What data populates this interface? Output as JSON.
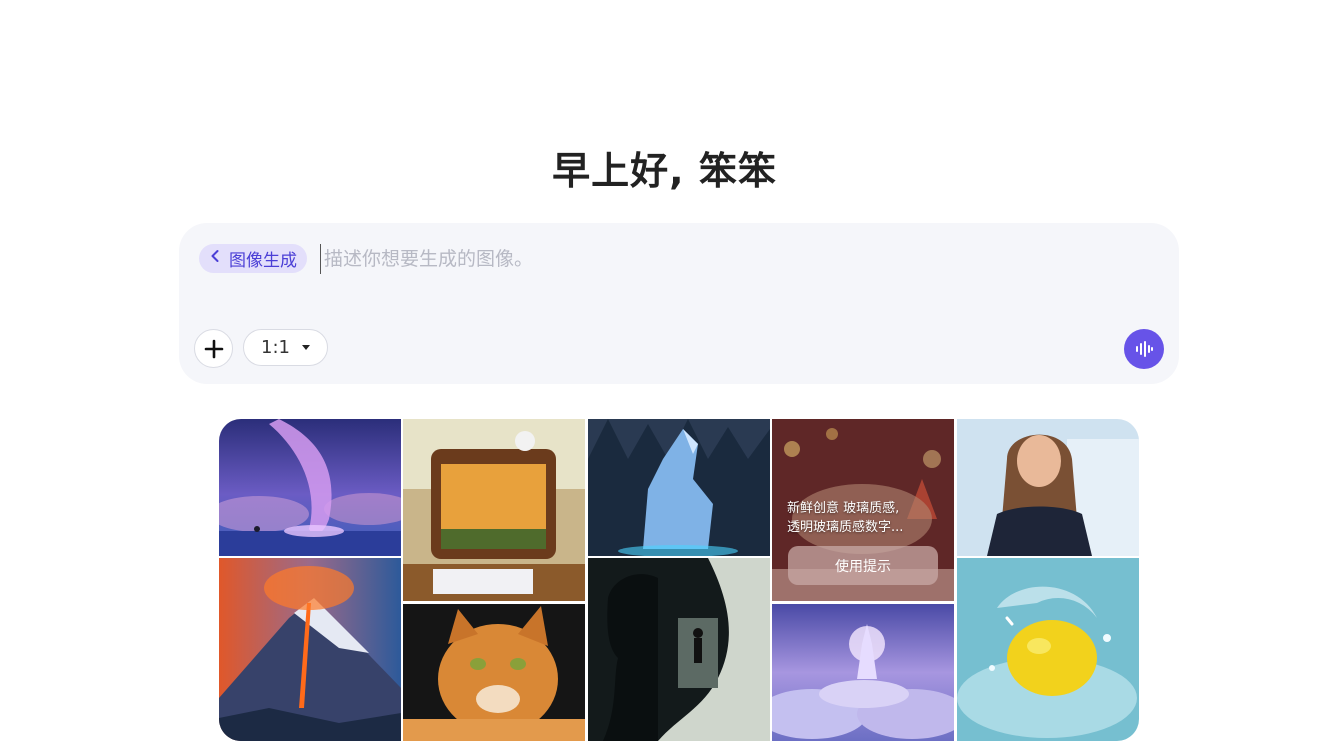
{
  "greeting": "早上好, 笨笨",
  "composer": {
    "mode_chip_label": "图像生成",
    "prompt_placeholder": "描述你想要生成的图像。",
    "prompt_value": "",
    "aspect_ratio": "1:1"
  },
  "gallery": {
    "hover_prompt_line1": "新鲜创意 玻璃质感,",
    "hover_prompt_line2": "透明玻璃质感数字...",
    "use_prompt_button": "使用提示"
  },
  "colors": {
    "accent": "#6753e8",
    "chip_bg": "#e3dffb",
    "composer_bg": "#f5f6fa"
  },
  "icons": {
    "back": "chevron-left-icon",
    "add": "plus-icon",
    "ratio_caret": "caret-down-icon",
    "voice": "voice-wave-icon"
  }
}
